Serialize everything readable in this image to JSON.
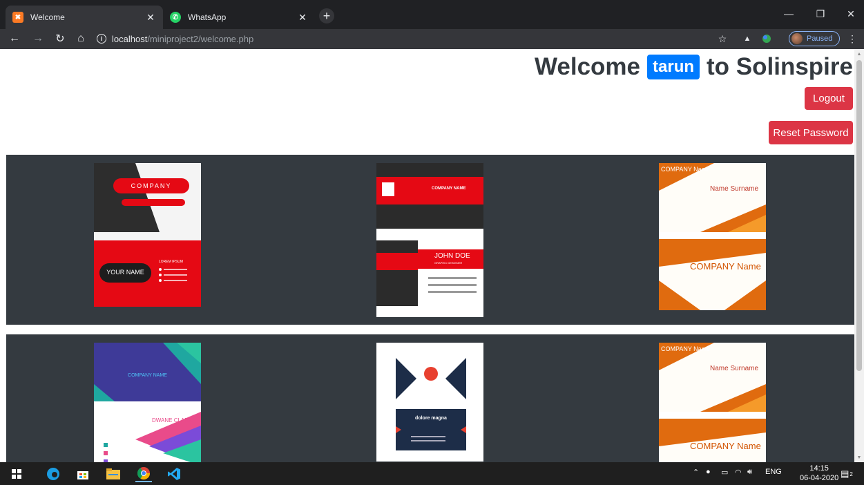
{
  "browser": {
    "tabs": [
      {
        "title": "Welcome",
        "favicon": "xampp-icon"
      },
      {
        "title": "WhatsApp",
        "favicon": "whatsapp-icon"
      }
    ],
    "url_host": "localhost",
    "url_path": "/miniproject2/welcome.php",
    "profile_label": "Paused"
  },
  "page": {
    "welcome_prefix": "Welcome",
    "username": "tarun",
    "welcome_suffix": "to Solinspire",
    "logout_label": "Logout",
    "reset_label": "Reset Password",
    "cards": [
      {
        "heading": "COMPANY",
        "name": "YOUR NAME",
        "extra": "LOREM IPSUM"
      },
      {
        "heading": "COMPANY NAME",
        "name": "JOHN DOE",
        "extra": "GRAPHIC DESIGNER"
      },
      {
        "heading": "COMPANY Name",
        "name": "Name Surname",
        "extra": "COMPANY Name"
      },
      {
        "heading": "COMPANY NAME",
        "name": "DWANE CLARK",
        "extra": ""
      },
      {
        "heading": "logo",
        "name": "dolore magna",
        "extra": ""
      },
      {
        "heading": "COMPANY Name",
        "name": "Name Surname",
        "extra": "COMPANY Name"
      }
    ]
  },
  "taskbar": {
    "lang": "ENG",
    "time": "14:15",
    "date": "06-04-2020",
    "notifications": "2"
  }
}
